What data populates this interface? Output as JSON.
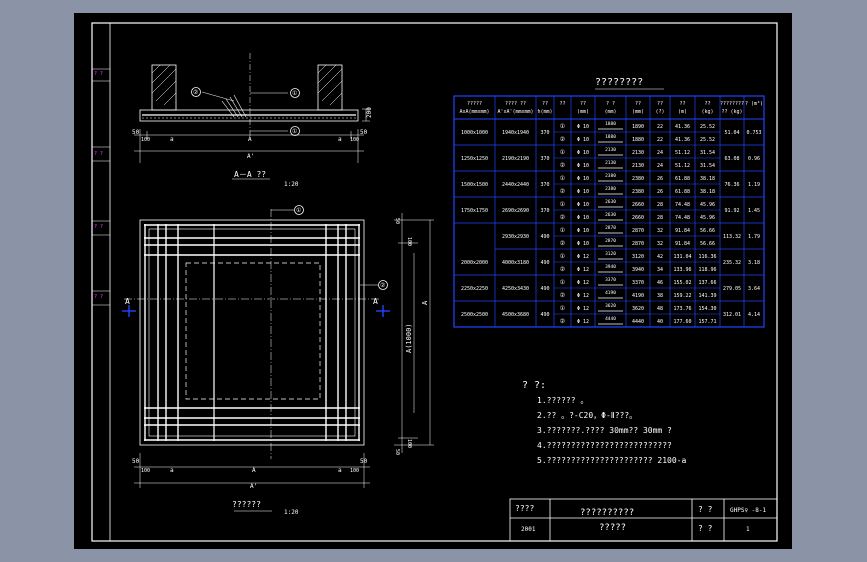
{
  "colors": {
    "canvas_bg": "#8b93a6",
    "paper": "#000000",
    "line": "#ffffff",
    "accent": "#1e46ff",
    "magenta": "#ff3cff",
    "dim": "#dcdcdc"
  },
  "section": {
    "title": "A－A ??",
    "scale": "1:20",
    "dim_200": "200",
    "dim_50_left": "50",
    "dim_50_right": "50",
    "dim_100_left": "100",
    "dim_100_right": "100",
    "dim_a_left": "a",
    "dim_a_right": "a",
    "dim_A": "A",
    "dim_Aprime": "A'",
    "callout_1": "①",
    "callout_2": "②"
  },
  "plan": {
    "title": "??????",
    "scale": "1:20",
    "section_mark_left": "A",
    "section_mark_right": "A",
    "dim_A_side": "A(1000)",
    "dim_A_vertical": "A",
    "dim_50_top": "50",
    "dim_50_bot": "50",
    "dim_100_top": "100",
    "dim_100_bot": "100",
    "bottom_50_left": "50",
    "bottom_50_right": "50",
    "bottom_100_left": "100",
    "bottom_100_right": "100",
    "bottom_a_left": "a",
    "bottom_a_right": "a",
    "bottom_A": "A",
    "bottom_Aprime": "A'",
    "callout_1": "①",
    "callout_2": "②"
  },
  "table": {
    "title": "????????",
    "headers": [
      "?????\nAxA(mmxmm)",
      "????  ??\nA'xA'(mmxmm)",
      "??\nh(mm)",
      "??",
      "??\n(mm)",
      "?  ?\n(mm)",
      "??\n(mm)",
      "??\n(?)",
      "??\n(m)",
      "??\n(kg)",
      "????????\n?? (kg)",
      "? (m³)"
    ],
    "rows": [
      {
        "size": "1000x1000",
        "outer": "1940x1940",
        "h": "370",
        "items": [
          {
            "no": "①",
            "dia": "Φ 10",
            "shape_len": "1880",
            "len": "1890",
            "n": "22",
            "total": "41.36",
            "wt": "25.52"
          },
          {
            "no": "②",
            "dia": "Φ 10",
            "shape_len": "1880",
            "len": "1880",
            "n": "22",
            "total": "41.36",
            "wt": "25.52"
          }
        ],
        "steel": "51.04",
        "conc": "0.753"
      },
      {
        "size": "1250x1250",
        "outer": "2190x2190",
        "h": "370",
        "items": [
          {
            "no": "①",
            "dia": "Φ 10",
            "shape_len": "2130",
            "len": "2130",
            "n": "24",
            "total": "51.12",
            "wt": "31.54"
          },
          {
            "no": "②",
            "dia": "Φ 10",
            "shape_len": "2130",
            "len": "2130",
            "n": "24",
            "total": "51.12",
            "wt": "31.54"
          }
        ],
        "steel": "63.08",
        "conc": "0.96"
      },
      {
        "size": "1500x1500",
        "outer": "2440x2440",
        "h": "370",
        "items": [
          {
            "no": "①",
            "dia": "Φ 10",
            "shape_len": "2380",
            "len": "2380",
            "n": "26",
            "total": "61.88",
            "wt": "38.18"
          },
          {
            "no": "②",
            "dia": "Φ 10",
            "shape_len": "2380",
            "len": "2380",
            "n": "26",
            "total": "61.88",
            "wt": "38.18"
          }
        ],
        "steel": "76.36",
        "conc": "1.19"
      },
      {
        "size": "1750x1750",
        "outer": "2690x2690",
        "h": "370",
        "items": [
          {
            "no": "①",
            "dia": "Φ 10",
            "shape_len": "2630",
            "len": "2660",
            "n": "28",
            "total": "74.48",
            "wt": "45.96"
          },
          {
            "no": "②",
            "dia": "Φ 10",
            "shape_len": "2630",
            "len": "2660",
            "n": "28",
            "total": "74.48",
            "wt": "45.96"
          }
        ],
        "steel": "91.92",
        "conc": "1.45"
      },
      {
        "size": "",
        "outer": "2930x2930",
        "h": "490",
        "items": [
          {
            "no": "①",
            "dia": "Φ 10",
            "shape_len": "2870",
            "len": "2870",
            "n": "32",
            "total": "91.84",
            "wt": "56.66"
          },
          {
            "no": "②",
            "dia": "Φ 10",
            "shape_len": "2870",
            "len": "2870",
            "n": "32",
            "total": "91.84",
            "wt": "56.66"
          }
        ],
        "steel": "113.32",
        "conc": "1.79"
      },
      {
        "size": "2000x2000",
        "outer": "4000x3180",
        "h": "490",
        "items": [
          {
            "no": "①",
            "dia": "Φ 12",
            "shape_len": "3120",
            "len": "3120",
            "n": "42",
            "total": "131.04",
            "wt": "116.36"
          },
          {
            "no": "②",
            "dia": "Φ 12",
            "shape_len": "3940",
            "len": "3940",
            "n": "34",
            "total": "133.96",
            "wt": "118.96"
          }
        ],
        "steel": "235.32",
        "conc": "3.18"
      },
      {
        "size": "2250x2250",
        "outer": "4250x3430",
        "h": "490",
        "items": [
          {
            "no": "①",
            "dia": "Φ 12",
            "shape_len": "3370",
            "len": "3370",
            "n": "46",
            "total": "155.02",
            "wt": "137.66"
          },
          {
            "no": "②",
            "dia": "Φ 12",
            "shape_len": "4190",
            "len": "4190",
            "n": "38",
            "total": "159.22",
            "wt": "141.39"
          }
        ],
        "steel": "279.05",
        "conc": "3.64"
      },
      {
        "size": "2500x2500",
        "outer": "4500x3680",
        "h": "490",
        "items": [
          {
            "no": "①",
            "dia": "Φ 12",
            "shape_len": "3620",
            "len": "3620",
            "n": "48",
            "total": "173.76",
            "wt": "154.30"
          },
          {
            "no": "②",
            "dia": "Φ 12",
            "shape_len": "4440",
            "len": "4440",
            "n": "40",
            "total": "177.60",
            "wt": "157.71"
          }
        ],
        "steel": "312.01",
        "conc": "4.14"
      }
    ]
  },
  "notes": {
    "heading": "? ?:",
    "items": [
      "1.??????  。",
      "2.??  。?-C20，Φ-Ⅱ???。",
      "3.???????.????        30mm??    30mm  ?",
      "4.??????????????????????????",
      "5.??????????????????????       2100-a"
    ]
  },
  "title_block": {
    "project_label": "????",
    "project_code": "2001",
    "drawing_name_1": "??????????",
    "drawing_name_2": "?????",
    "drawing_no_label": "?  ?",
    "drawing_no": "GHPS♀ -8-1",
    "page_label": "?  ?",
    "page_no": "1"
  }
}
